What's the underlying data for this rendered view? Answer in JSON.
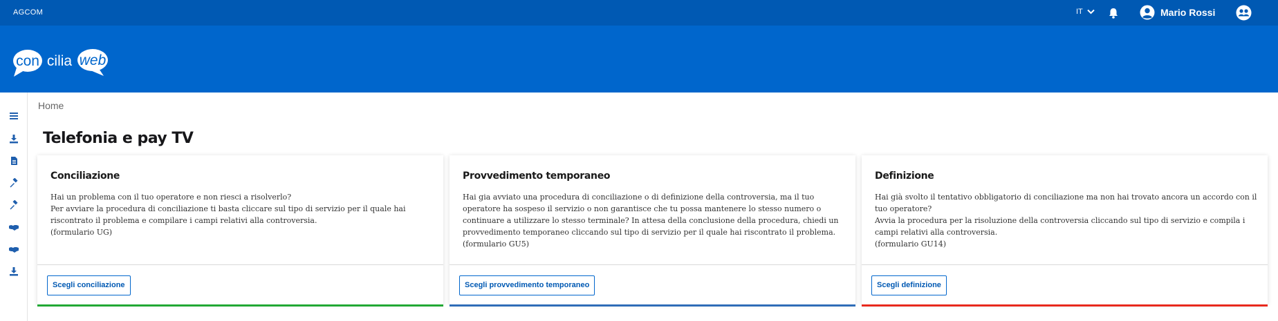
{
  "topbar": {
    "brand": "AGCOM",
    "language": "IT",
    "user_name": "Mario Rossi"
  },
  "logo": {
    "part_con": "con",
    "part_cilia": "cilia",
    "part_web": "web"
  },
  "breadcrumb": "Home",
  "page_title": "Telefonia e pay TV",
  "cards": [
    {
      "title": "Conciliazione",
      "text": [
        "Hai un problema con il tuo operatore e non riesci a risolverlo?",
        "Per avviare la procedura di conciliazione ti basta cliccare sul tipo di servizio per il quale hai riscontrato il problema e compilare i campi relativi alla controversia.",
        "(formulario UG)"
      ],
      "button": "Scegli conciliazione",
      "accent_color": "#22a834"
    },
    {
      "title": "Provvedimento temporaneo",
      "text": [
        "Hai gia avviato una procedura di conciliazione o di definizione della controversia, ma il tuo operatore ha sospeso il servizio o non garantisce che tu possa mantenere lo stesso numero o continuare a utilizzare lo stesso terminale? In attesa della conclusione della procedura, chiedi un provvedimento temporaneo cliccando sul tipo di servizio per il quale hai riscontrato il problema.",
        "(formulario GU5)"
      ],
      "button": "Scegli provvedimento temporaneo",
      "accent_color": "#2f6db8"
    },
    {
      "title": "Definizione",
      "text": [
        "Hai già svolto il tentativo obbligatorio di conciliazione ma non hai trovato ancora un accordo con il tuo operatore?",
        "Avvia la procedura per la risoluzione della controversia cliccando sul tipo di servizio e compila i campi relativi alla controversia.",
        "(formulario GU14)"
      ],
      "button": "Scegli definizione",
      "accent_color": "#e8291c"
    }
  ],
  "sidebar_icons": [
    "menu-icon",
    "download-icon",
    "document-icon",
    "gavel-icon",
    "gavel-icon",
    "handshake-icon",
    "handshake-icon",
    "download-icon"
  ]
}
